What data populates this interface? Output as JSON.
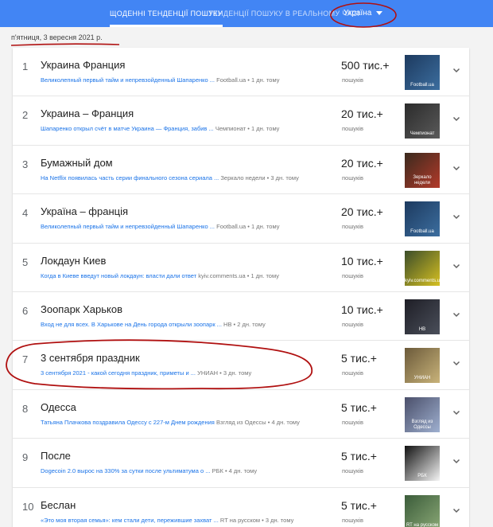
{
  "header": {
    "tab_daily": "ЩОДЕННІ ТЕНДЕНЦІЇ ПОШУКУ",
    "tab_realtime": "ТЕНДЕНЦІЇ ПОШУКУ В РЕАЛЬНОМУ ЧАСІ",
    "country": "Україна"
  },
  "date": "п'ятниця, 3 вересня 2021 р.",
  "rows": [
    {
      "rank": "1",
      "title": "Украина Франция",
      "article": "Великолепный первый тайм и непревзойденный Шапаренко ...",
      "source": "Football.ua • 1 дн. тому",
      "count": "500 тис.+",
      "count_label": "пошуків",
      "thumb_label": "Football.ua"
    },
    {
      "rank": "2",
      "title": "Украина – Франция",
      "article": "Шапаренко открыл счёт в матче Украина — Франция, забив ...",
      "source": "Чемпионат • 1 дн. тому",
      "count": "20 тис.+",
      "count_label": "пошуків",
      "thumb_label": "Чемпионат"
    },
    {
      "rank": "3",
      "title": "Бумажный дом",
      "article": "На Netflix появилась часть серии финального сезона сериала ...",
      "source": "Зеркало недели • 3 дн. тому",
      "count": "20 тис.+",
      "count_label": "пошуків",
      "thumb_label": "Зеркало недели"
    },
    {
      "rank": "4",
      "title": "Україна – франція",
      "article": "Великолепный первый тайм и непревзойденный Шапаренко ...",
      "source": "Football.ua • 1 дн. тому",
      "count": "20 тис.+",
      "count_label": "пошуків",
      "thumb_label": "Football.ua"
    },
    {
      "rank": "5",
      "title": "Локдаун Киев",
      "article": "Когда в Киеве введут новый локдаун: власти дали ответ",
      "source": "kyiv.comments.ua • 1 дн. тому",
      "count": "10 тис.+",
      "count_label": "пошуків",
      "thumb_label": "kyiv.comments.ua"
    },
    {
      "rank": "6",
      "title": "Зоопарк Харьков",
      "article": "Вход не для всех. В Харькове на День города открыли зоопарк ...",
      "source": "НВ • 2 дн. тому",
      "count": "10 тис.+",
      "count_label": "пошуків",
      "thumb_label": "НВ"
    },
    {
      "rank": "7",
      "title": "3 сентября праздник",
      "article": "3 сентября 2021 - какой сегодня праздник, приметы и ...",
      "source": "УНИАН • 3 дн. тому",
      "count": "5 тис.+",
      "count_label": "пошуків",
      "thumb_label": "УНИАН"
    },
    {
      "rank": "8",
      "title": "Одесса",
      "article": "Татьяна Плачкова поздравила Одессу с 227-м Днем рождения",
      "source": "Взгляд из Одессы • 4 дн. тому",
      "count": "5 тис.+",
      "count_label": "пошуків",
      "thumb_label": "Взгляд из Одессы"
    },
    {
      "rank": "9",
      "title": "После",
      "article": "Dogecoin 2.0 вырос на 330% за сутки после ультиматума о ...",
      "source": "РБК • 4 дн. тому",
      "count": "5 тис.+",
      "count_label": "пошуків",
      "thumb_label": "РБК"
    },
    {
      "rank": "10",
      "title": "Беслан",
      "article": "«Это моя вторая семья»: кем стали дети, пережившие захват ...",
      "source": "RT на русском • 3 дн. тому",
      "count": "5 тис.+",
      "count_label": "пошуків",
      "thumb_label": "RT на русском"
    }
  ],
  "colors": {
    "header_bg": "#4285f4",
    "link": "#1a73e8",
    "annotation": "#b01010"
  }
}
